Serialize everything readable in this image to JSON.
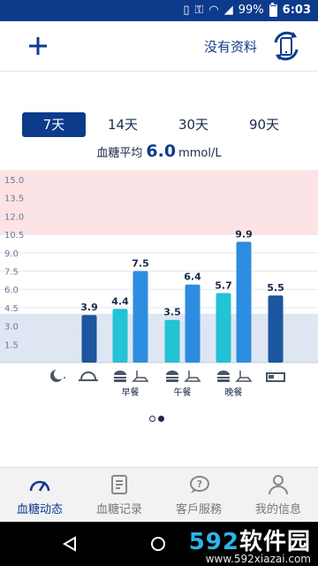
{
  "status": {
    "battery": "99%",
    "time": "6:03"
  },
  "header": {
    "add_icon": "plus-icon",
    "no_data_label": "没有资料",
    "sync_icon": "phone-sync-icon"
  },
  "ranges": [
    {
      "label": "7天",
      "active": true
    },
    {
      "label": "14天",
      "active": false
    },
    {
      "label": "30天",
      "active": false
    },
    {
      "label": "90天",
      "active": false
    }
  ],
  "average": {
    "label": "血糖平均",
    "value": "6.0",
    "unit": "mmol/L"
  },
  "chart_data": {
    "type": "bar",
    "ylim": [
      0,
      15.8
    ],
    "y_ticks": [
      "15.0",
      "13.5",
      "12.0",
      "10.5",
      "9.0",
      "7.5",
      "6.0",
      "4.5",
      "3.0",
      "1.5"
    ],
    "bands": [
      {
        "from": 10.5,
        "to": 15.8,
        "color": "#fde3e6"
      },
      {
        "from": 0,
        "to": 4.0,
        "color": "#dfe6f3"
      }
    ],
    "categories": [
      "凌晨",
      "早餐前",
      "早餐后",
      "午餐前",
      "午餐后",
      "晚餐前",
      "晚餐后",
      "睡前"
    ],
    "values": [
      null,
      3.9,
      4.4,
      7.5,
      3.5,
      6.4,
      5.7,
      9.9,
      5.5
    ],
    "bar_values": [
      {
        "slot": 1,
        "value": 3.9,
        "color": "#1b569f"
      },
      {
        "slot": 2,
        "value": 4.4,
        "color": "#23c2d4"
      },
      {
        "slot": 3,
        "value": 7.5,
        "color": "#2c8de0"
      },
      {
        "slot": 4,
        "value": 3.5,
        "color": "#23c2d4"
      },
      {
        "slot": 5,
        "value": 6.4,
        "color": "#2c8de0"
      },
      {
        "slot": 6,
        "value": 5.7,
        "color": "#23c2d4"
      },
      {
        "slot": 7,
        "value": 9.9,
        "color": "#2c8de0"
      },
      {
        "slot": 8,
        "value": 5.5,
        "color": "#1b569f"
      }
    ],
    "meal_labels": [
      "早餐",
      "午餐",
      "晚餐"
    ]
  },
  "pager": {
    "count": 2,
    "active": 1
  },
  "tabs": [
    {
      "label": "血糖动态",
      "icon": "gauge-icon",
      "active": true
    },
    {
      "label": "血糖记录",
      "icon": "notebook-icon",
      "active": false
    },
    {
      "label": "客戶服務",
      "icon": "help-bubble-icon",
      "active": false
    },
    {
      "label": "我的信息",
      "icon": "person-icon",
      "active": false
    }
  ],
  "watermark": {
    "brand_num": "592",
    "brand_text": "软件园",
    "url": "www.592xiazai.com"
  }
}
